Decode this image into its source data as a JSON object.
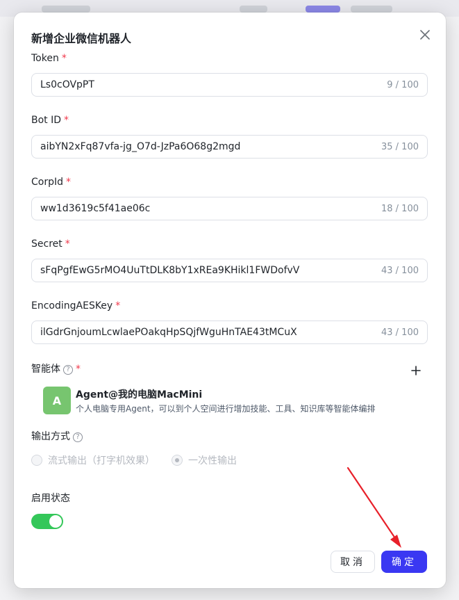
{
  "dialog": {
    "title": "新增企业微信机器人",
    "required_mark": "*"
  },
  "fields": {
    "token": {
      "label": "Token",
      "value": "Ls0cOVpPT",
      "count": "9 / 100"
    },
    "bot_id": {
      "label": "Bot ID",
      "value": "aibYN2xFq87vfa-jg_O7d-JzPa6O68g2mgd",
      "count": "35 / 100"
    },
    "corp_id": {
      "label": "CorpId",
      "value": "ww1d3619c5f41ae06c",
      "count": "18 / 100"
    },
    "secret": {
      "label": "Secret",
      "value": "sFqPgfEwG5rMO4UuTtDLK8bY1xREa9KHikl1FWDofvV",
      "count": "43 / 100"
    },
    "encoding_aes_key": {
      "label": "EncodingAESKey",
      "value": "ilGdrGnjoumLcwlaePOakqHpSQjfWguHnTAE43tMCuX",
      "count": "43 / 100"
    }
  },
  "agent": {
    "label": "智能体",
    "avatar_letter": "A",
    "name": "Agent@我的电脑MacMini",
    "description": "个人电脑专用Agent，可以到个人空间进行增加技能、工具、知识库等智能体编排",
    "avatar_color": "#77c56f"
  },
  "output": {
    "label": "输出方式",
    "options": [
      "流式输出（打字机效果）",
      "一次性输出"
    ],
    "selected": "一次性输出"
  },
  "status": {
    "label": "启用状态",
    "enabled": true,
    "toggle_color": "#34c759"
  },
  "buttons": {
    "cancel": "取消",
    "confirm": "确定"
  },
  "colors": {
    "primary": "#3a38f2",
    "required": "#f0384b",
    "annotation_arrow": "#e8202a"
  },
  "icons": {
    "close": "close-icon",
    "help": "help-circle-icon",
    "add": "plus-icon"
  }
}
